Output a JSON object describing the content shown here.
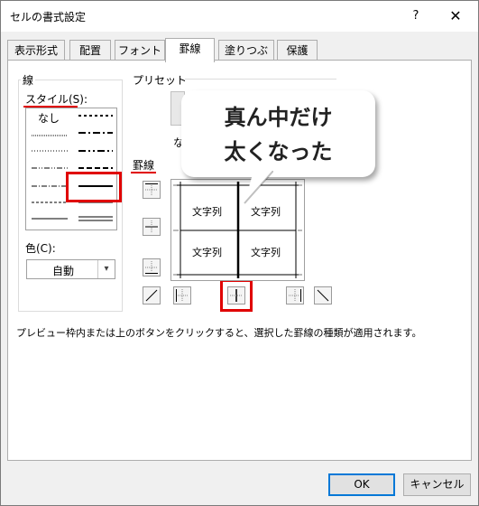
{
  "dialog": {
    "title": "セルの書式設定",
    "help_label": "?",
    "close_label": "✕"
  },
  "tabs": [
    {
      "label": "表示形式"
    },
    {
      "label": "配置"
    },
    {
      "label": "フォント"
    },
    {
      "label": "罫線",
      "active": true
    },
    {
      "label": "塗りつぶし"
    },
    {
      "label": "保護"
    }
  ],
  "line_group": {
    "title": "線",
    "style_label": "スタイル(S):",
    "none_label": "なし",
    "color_label": "色(C):",
    "color_value": "自動"
  },
  "preset_group": {
    "title": "プリセット",
    "partial_label": "な"
  },
  "border_group": {
    "title": "罫線"
  },
  "preview": {
    "cell_text": "文字列"
  },
  "hint": "プレビュー枠内または上のボタンをクリックすると、選択した罫線の種類が適用されます。",
  "callout": {
    "line1": "真ん中だけ",
    "line2": "太くなった"
  },
  "buttons": {
    "ok": "OK",
    "cancel": "キャンセル"
  },
  "colors": {
    "highlight": "#e00000",
    "accent": "#0078d7"
  },
  "icons": {
    "border_buttons": [
      "border-top-icon",
      "border-inner-horizontal-icon",
      "border-bottom-icon",
      "border-diagonal-up-icon",
      "border-left-icon",
      "border-inner-vertical-icon",
      "border-right-icon",
      "border-diagonal-down-icon"
    ]
  }
}
